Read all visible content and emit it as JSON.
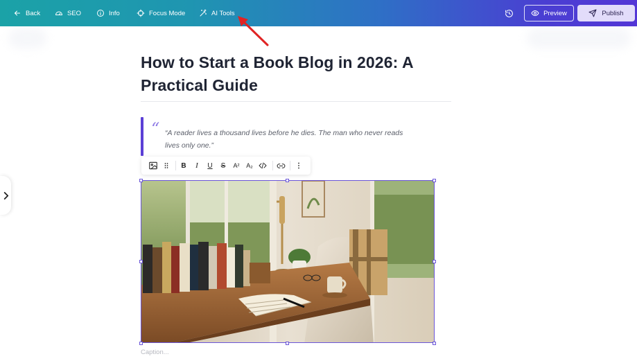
{
  "topbar": {
    "back_label": "Back",
    "seo_label": "SEO",
    "info_label": "Info",
    "focus_label": "Focus Mode",
    "ai_label": "AI Tools",
    "preview_label": "Preview",
    "publish_label": "Publish"
  },
  "post": {
    "title": "How to Start a Book Blog in 2026: A Practical Guide",
    "quote_mark": "“",
    "quote_text": "“A reader lives a thousand lives before he dies. The man who never reads lives only one.”"
  },
  "toolbar": {
    "bold": "B",
    "italic": "I",
    "underline": "U",
    "strike": "S",
    "superscript": "A²",
    "subscript": "A₂"
  },
  "image": {
    "caption_placeholder": "Caption..."
  },
  "icons": {
    "back": "arrow-left-icon",
    "seo": "gauge-icon",
    "info": "info-icon",
    "focus": "crosshair-icon",
    "ai": "magic-wand-icon",
    "history": "history-icon",
    "preview": "eye-icon",
    "publish": "send-icon"
  },
  "colors": {
    "accent": "#5b3fd6",
    "selection": "#6a55d8",
    "annotation": "#e02424"
  }
}
